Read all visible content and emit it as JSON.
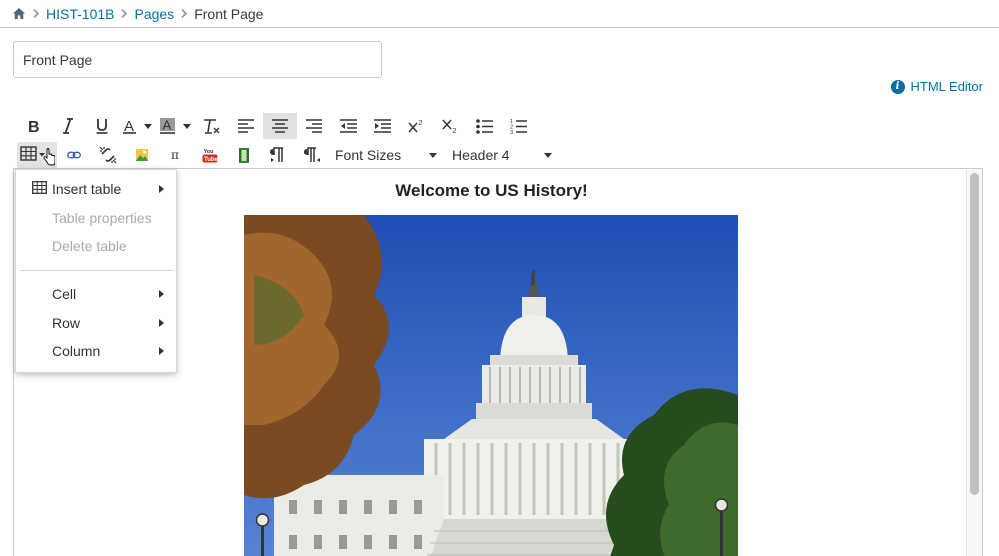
{
  "breadcrumb": {
    "home_icon": "home-icon",
    "items": [
      {
        "label": "HIST-101B",
        "link": true
      },
      {
        "label": "Pages",
        "link": true
      },
      {
        "label": "Front Page",
        "link": false
      }
    ]
  },
  "title_input": {
    "value": "Front Page"
  },
  "html_editor": {
    "label": "HTML Editor",
    "icon": "info-icon"
  },
  "toolbar": {
    "row1_icons": [
      "bold-icon",
      "italic-icon",
      "underline-icon",
      "text-color-icon",
      "background-color-icon",
      "clear-formatting-icon",
      "align-left-icon",
      "align-center-icon",
      "align-right-icon",
      "outdent-icon",
      "indent-icon",
      "superscript-icon",
      "subscript-icon",
      "bullet-list-icon",
      "numbered-list-icon"
    ],
    "row2_icons": [
      "table-icon",
      "link-icon",
      "unlink-icon",
      "image-icon",
      "math-pi-icon",
      "youtube-icon",
      "media-icon",
      "ltr-paragraph-icon",
      "rtl-paragraph-icon"
    ],
    "font_sizes_label": "Font Sizes",
    "format_label": "Header 4"
  },
  "table_menu": {
    "items": [
      {
        "label": "Insert table",
        "enabled": true,
        "submenu": true,
        "icon": "table-icon"
      },
      {
        "label": "Table properties",
        "enabled": false,
        "submenu": false
      },
      {
        "label": "Delete table",
        "enabled": false,
        "submenu": false
      },
      {
        "label": "Cell",
        "enabled": true,
        "submenu": true
      },
      {
        "label": "Row",
        "enabled": true,
        "submenu": true
      },
      {
        "label": "Column",
        "enabled": true,
        "submenu": true
      }
    ]
  },
  "editor": {
    "heading": "Welcome to US History!",
    "image": "us-capitol-photo"
  },
  "colors": {
    "link": "#0770a3",
    "text": "#2d3b45",
    "border": "#c7cdd1",
    "sky": "#2e5bbd"
  }
}
